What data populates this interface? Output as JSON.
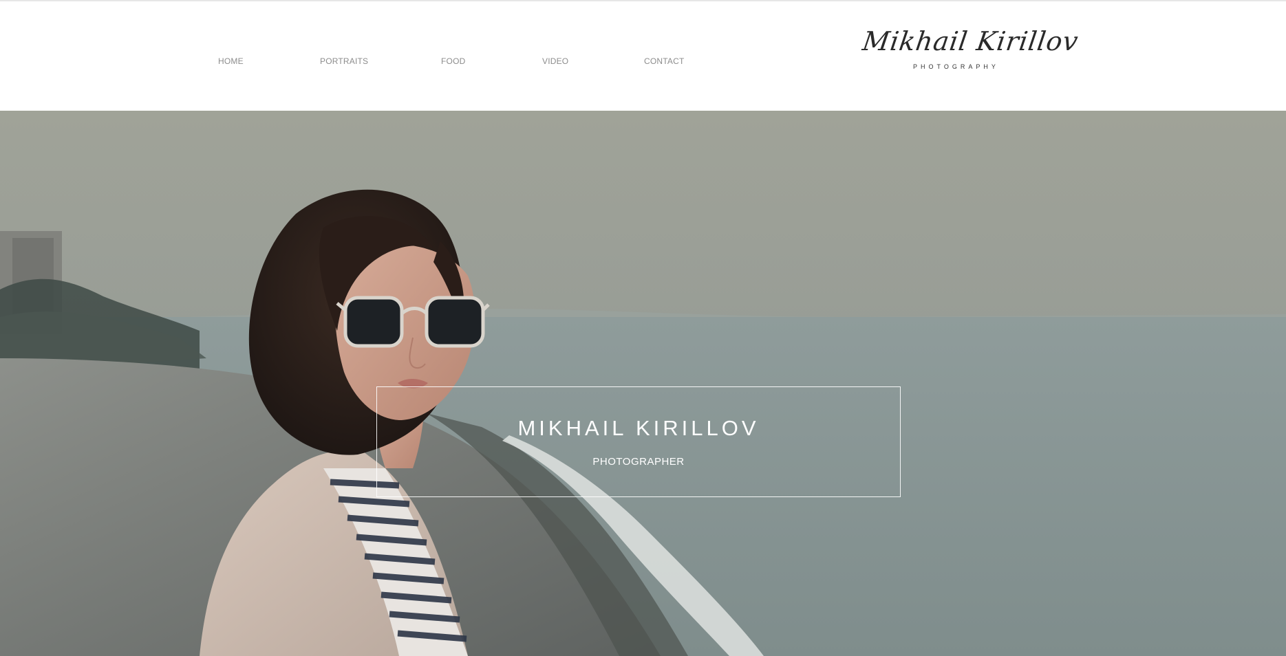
{
  "nav": {
    "items": [
      {
        "label": "HOME"
      },
      {
        "label": "PORTRAITS"
      },
      {
        "label": "FOOD"
      },
      {
        "label": "VIDEO"
      },
      {
        "label": "CONTACT"
      }
    ]
  },
  "logo": {
    "script": "Mikhail Kirillov",
    "sub": "PHOTOGRAPHY"
  },
  "hero": {
    "title": "MIKHAIL KIRILLOV",
    "subtitle": "PHOTOGRAPHER"
  },
  "colors": {
    "nav_text": "#8c8c8c",
    "logo_text": "#2a2a2a",
    "hero_text": "#ffffff",
    "hero_overlay_border": "#ffffff"
  }
}
